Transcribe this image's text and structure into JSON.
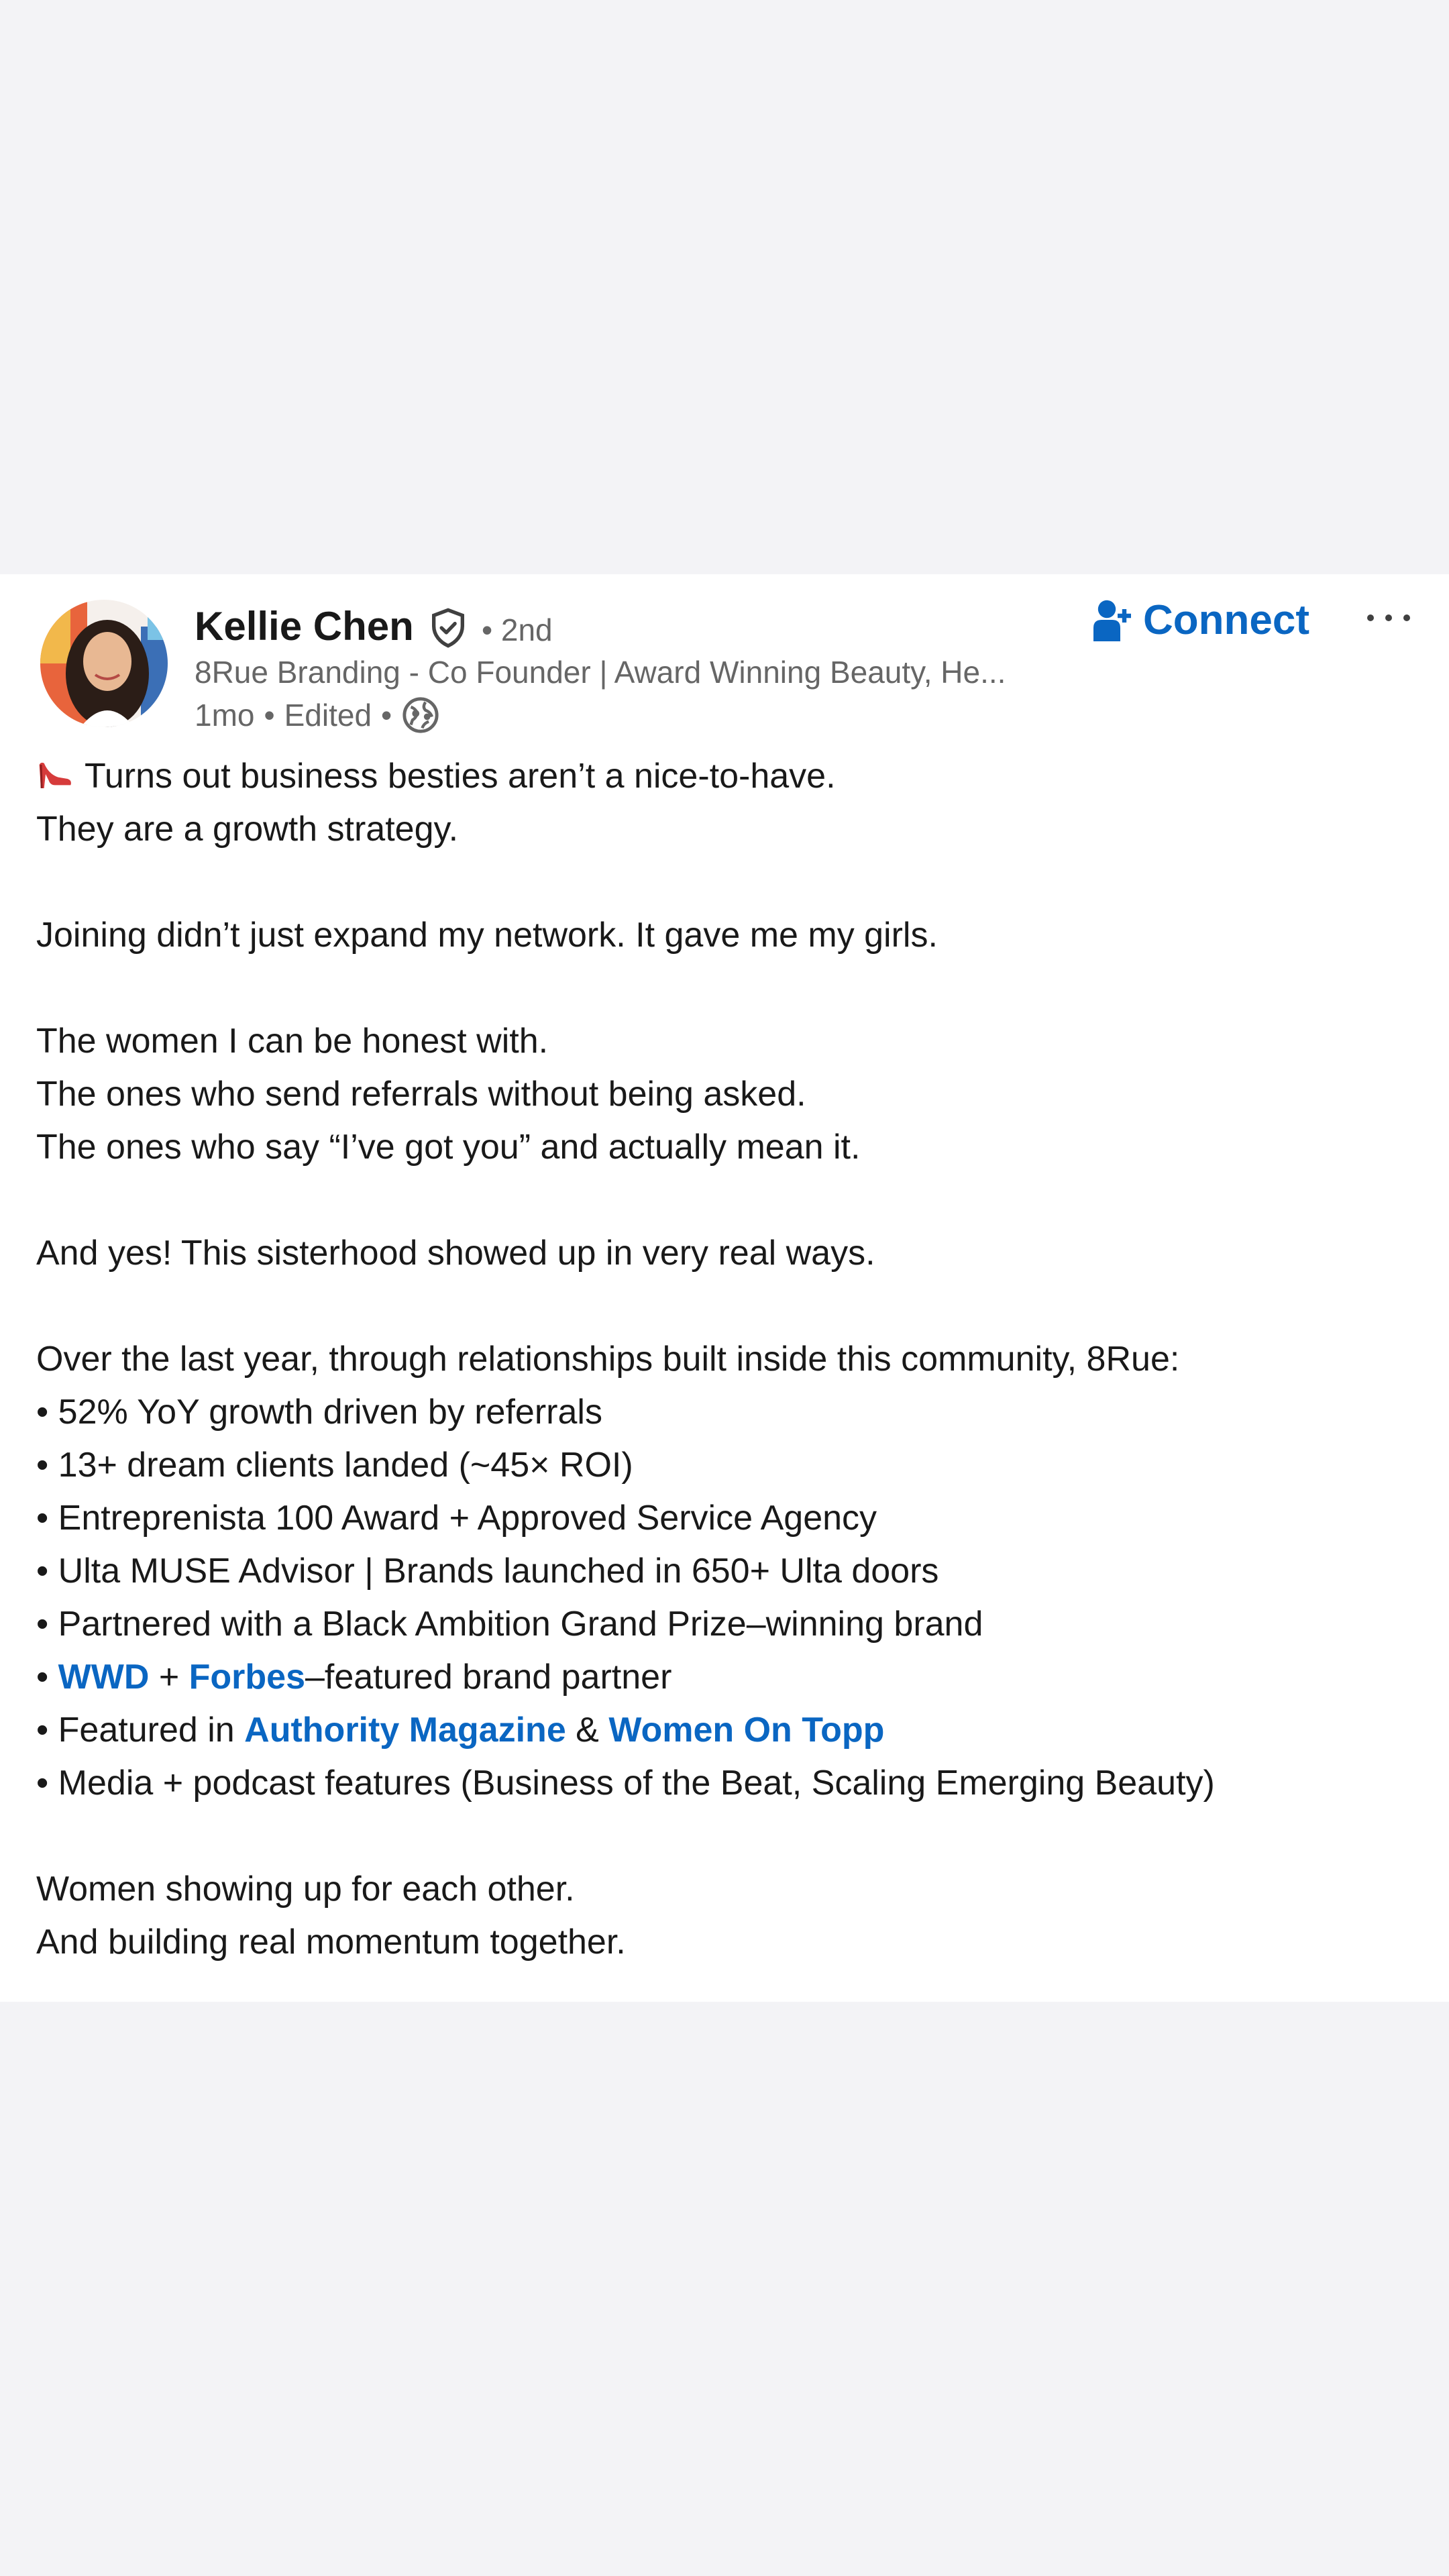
{
  "post": {
    "author": {
      "name": "Kellie Chen",
      "degree": "• 2nd",
      "headline": "8Rue Branding - Co Founder | Award Winning Beauty, He...",
      "time": "1mo",
      "edited": "Edited"
    },
    "actions": {
      "connect_label": "Connect"
    },
    "body": {
      "line1": "Turns out business besties aren’t a nice-to-have.",
      "line2": "They are a growth strategy.",
      "line3": "Joining  didn’t just expand my network. It gave me my girls.",
      "line4": "The women I can be honest with.",
      "line5": "The ones who send referrals without being asked.",
      "line6": "The ones who say “I’ve got you” and actually mean it.",
      "line7": "And yes! This sisterhood showed up in very real ways.",
      "line8": "Over the last year, through relationships built inside this community, 8Rue:",
      "bullet": "• ",
      "b1": "52% YoY growth driven by referrals",
      "b2": "13+ dream clients landed (~45× ROI)",
      "b3": "Entreprenista 100 Award + Approved Service Agency",
      "b4": "Ulta MUSE Advisor | Brands launched in 650+ Ulta doors",
      "b5": "Partnered with a Black Ambition Grand Prize–winning brand",
      "b6_link1": "WWD",
      "b6_plus": " + ",
      "b6_link2": "Forbes",
      "b6_rest": "–featured brand partner",
      "b7_prefix": "Featured in ",
      "b7_link1": "Authority Magazine",
      "b7_amp": " & ",
      "b7_link2": "Women On Topp",
      "b8": "Media + podcast features (Business of the Beat, Scaling Emerging Beauty)",
      "line9": "Women showing up for each other.",
      "line10": "And building real momentum together."
    }
  },
  "icons": {
    "verified": "verified-shield-icon",
    "globe": "globe-icon",
    "connect": "add-person-icon",
    "more": "more-horizontal-icon",
    "emoji": "high-heel-shoe-icon"
  },
  "colors": {
    "link": "#0a66c2",
    "text": "#191919",
    "secondary": "#666666",
    "page_bg": "#f3f3f6"
  }
}
